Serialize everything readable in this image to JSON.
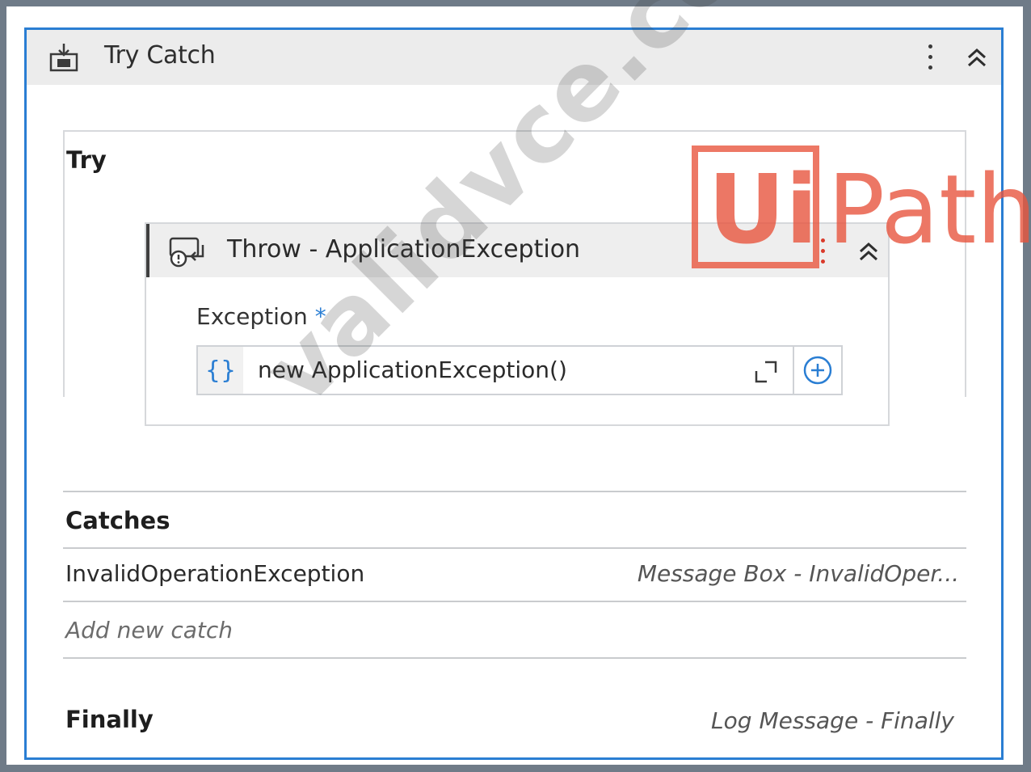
{
  "activity": {
    "title": "Try Catch",
    "icon": "try-catch-icon"
  },
  "try_section": {
    "label": "Try",
    "throw_activity": {
      "title": "Throw - ApplicationException",
      "icon": "throw-icon",
      "field_label": "Exception",
      "required_marker": "*",
      "expression_prefix": "{}",
      "expression": "new ApplicationException()"
    }
  },
  "catches_section": {
    "label": "Catches",
    "items": [
      {
        "exception": "InvalidOperationException",
        "handler": "Message Box - InvalidOper..."
      }
    ],
    "add_label": "Add new catch"
  },
  "finally_section": {
    "label": "Finally",
    "handler": "Log Message - Finally"
  },
  "overlays": {
    "watermark": "validvce.com",
    "logo": "UiPath"
  },
  "colors": {
    "accent": "#2a7ed3",
    "logo": "#e8563f",
    "header_bg": "#ececec"
  }
}
